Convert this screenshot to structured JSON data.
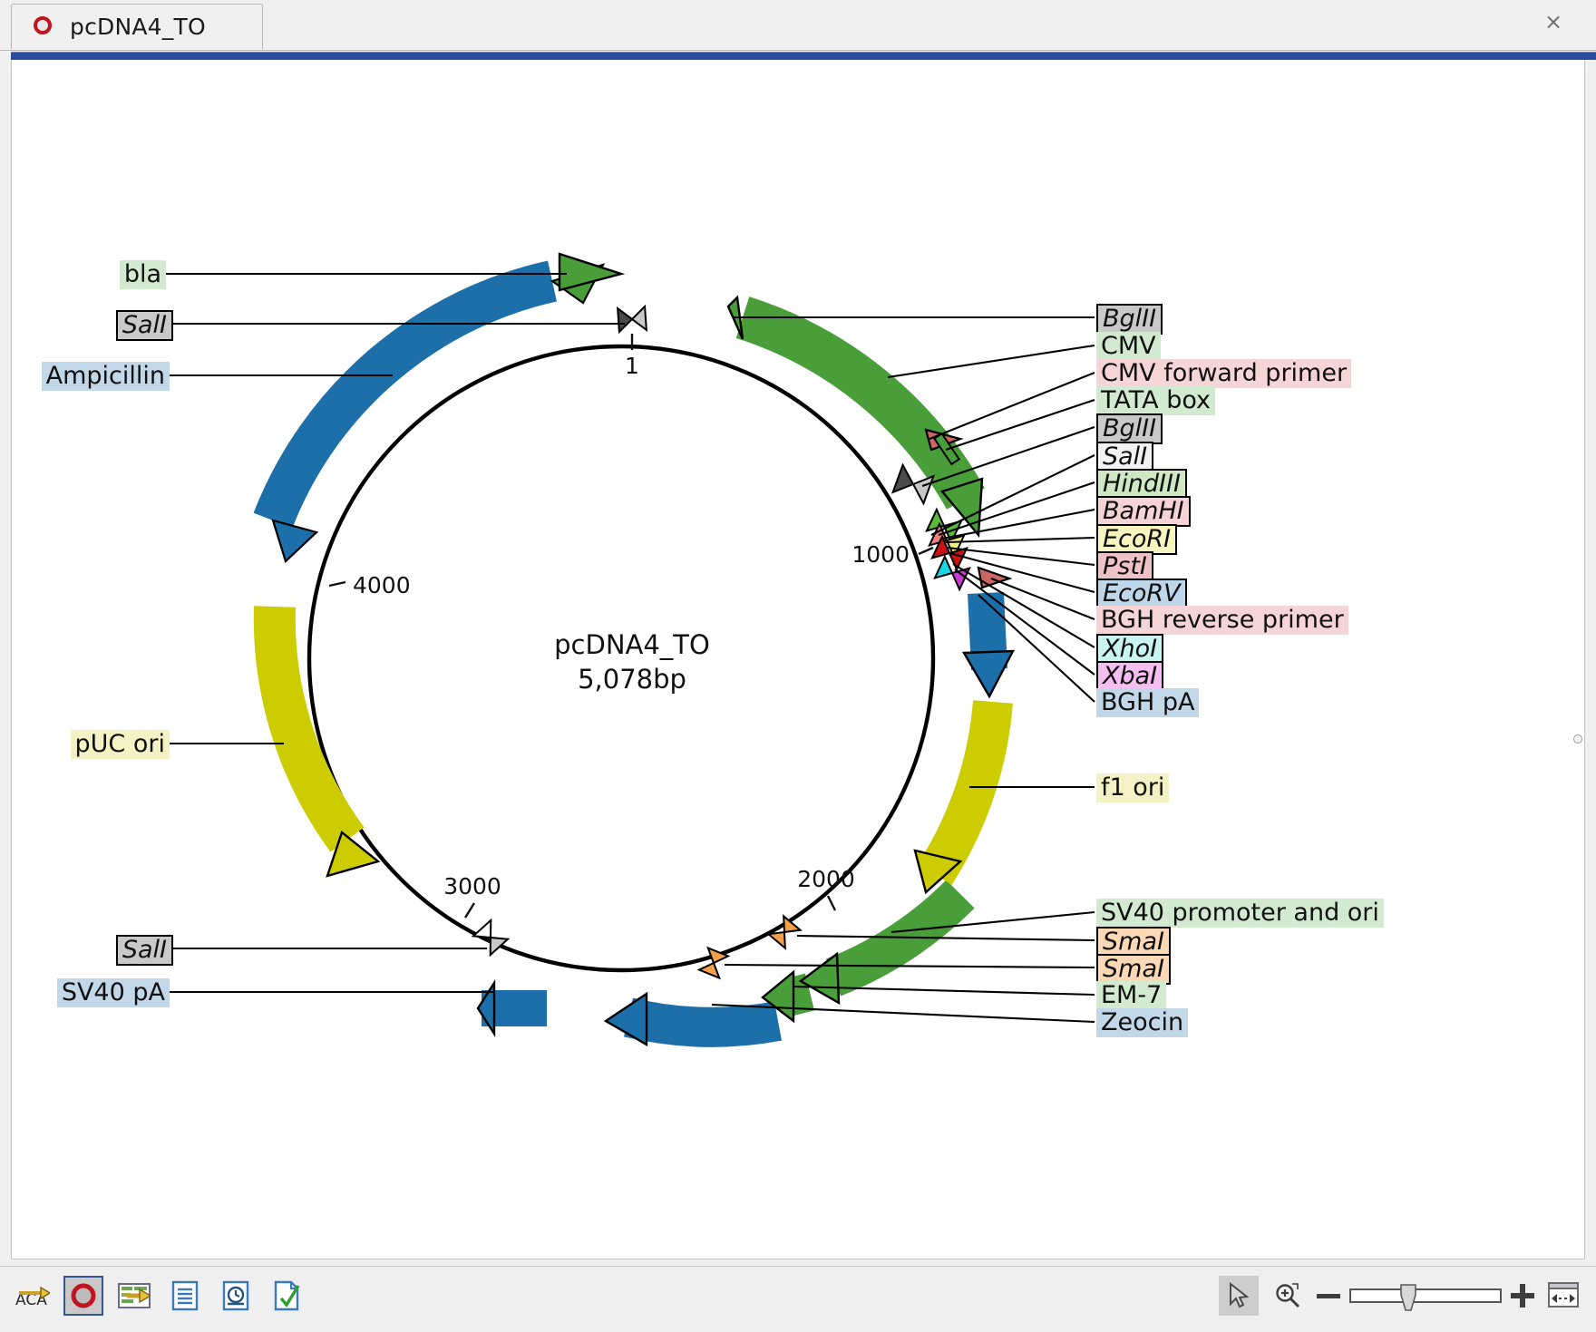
{
  "window": {
    "tab_title": "pcDNA4_TO",
    "tab_icon": "plasmid-ring-icon",
    "close_icon": "×"
  },
  "map": {
    "name": "pcDNA4_TO",
    "size_label": "5,078bp",
    "origin_tick_label": "1",
    "ruler_ticks": [
      "1000",
      "2000",
      "3000",
      "4000"
    ],
    "accent_colors": {
      "green_feature": "#4a9e3a",
      "blue_feature": "#1c6fa8",
      "yellow_feature": "#cccc00",
      "red_primer": "#cc6666",
      "backbone": "#000000"
    }
  },
  "labels_left": [
    {
      "text": "bla",
      "style": "feature-green"
    },
    {
      "text": "SalI",
      "style": "site-gray"
    },
    {
      "text": "Ampicillin",
      "style": "feature-blue"
    },
    {
      "text": "pUC ori",
      "style": "feature-yellow"
    },
    {
      "text": "SalI",
      "style": "site-gray"
    },
    {
      "text": "SV40 pA",
      "style": "feature-blue"
    }
  ],
  "labels_right": [
    {
      "text": "BglII",
      "style": "site-gray"
    },
    {
      "text": "CMV",
      "style": "feature-green"
    },
    {
      "text": "CMV forward primer",
      "style": "primer-pink"
    },
    {
      "text": "TATA box",
      "style": "feature-green"
    },
    {
      "text": "BglII",
      "style": "site-gray"
    },
    {
      "text": "SalI",
      "style": "site-white"
    },
    {
      "text": "HindIII",
      "style": "site-green"
    },
    {
      "text": "BamHI",
      "style": "site-pink"
    },
    {
      "text": "EcoRI",
      "style": "site-yellow"
    },
    {
      "text": "PstI",
      "style": "site-rose"
    },
    {
      "text": "EcoRV",
      "style": "site-blue"
    },
    {
      "text": "BGH reverse primer",
      "style": "primer-pink"
    },
    {
      "text": "XhoI",
      "style": "site-cyan"
    },
    {
      "text": "XbaI",
      "style": "site-magenta"
    },
    {
      "text": "BGH pA",
      "style": "feature-blue"
    },
    {
      "text": "f1 ori",
      "style": "feature-yellow"
    },
    {
      "text": "SV40 promoter and ori",
      "style": "feature-green"
    },
    {
      "text": "SmaI",
      "style": "site-orange"
    },
    {
      "text": "SmaI",
      "style": "site-orange"
    },
    {
      "text": "EM-7",
      "style": "feature-green"
    },
    {
      "text": "Zeocin",
      "style": "feature-blue"
    }
  ],
  "toolbar": {
    "left_buttons": [
      {
        "name": "translate-icon",
        "title": "ACA"
      },
      {
        "name": "plasmid-map-icon",
        "title": "Map"
      },
      {
        "name": "sequence-icon",
        "title": "Sequence"
      },
      {
        "name": "enzymes-icon",
        "title": "Enzymes"
      },
      {
        "name": "history-icon",
        "title": "History"
      },
      {
        "name": "check-doc-icon",
        "title": "Check"
      }
    ],
    "right_buttons": [
      {
        "name": "pointer-tool-icon",
        "title": "Select"
      },
      {
        "name": "zoom-tool-icon",
        "title": "Zoom"
      },
      {
        "name": "zoom-out-icon",
        "title": "Zoom out"
      },
      {
        "name": "zoom-slider",
        "title": "Zoom level"
      },
      {
        "name": "zoom-in-icon",
        "title": "Zoom in"
      },
      {
        "name": "fit-width-icon",
        "title": "Fit"
      }
    ]
  }
}
